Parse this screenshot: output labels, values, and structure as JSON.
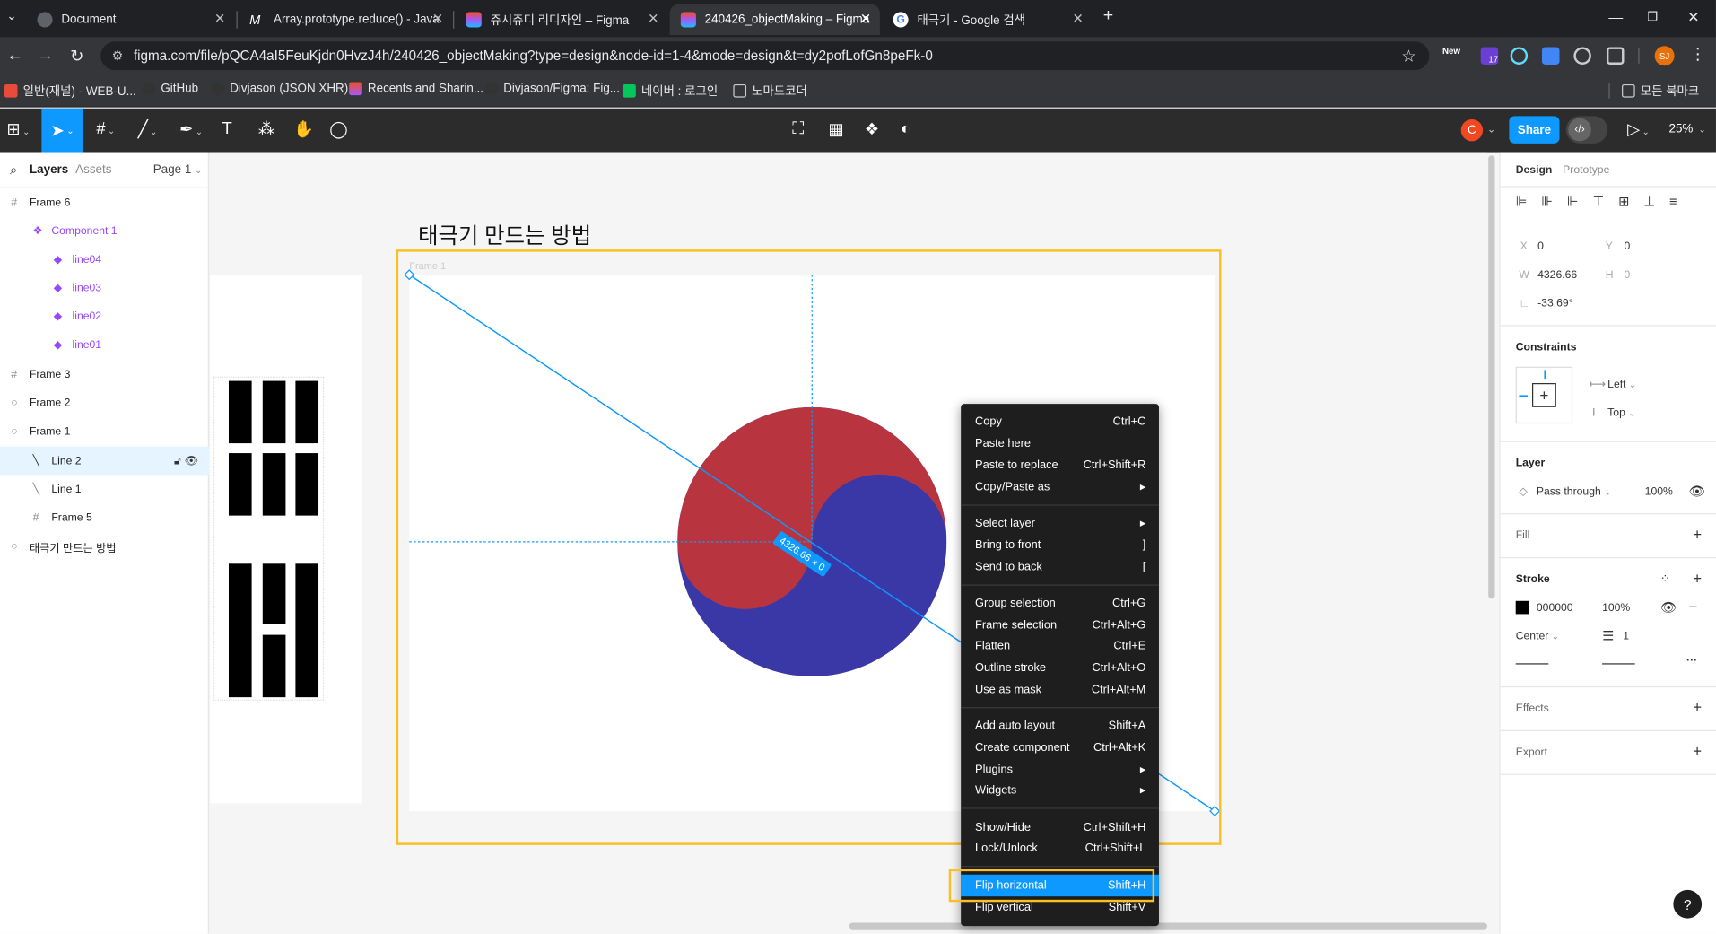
{
  "browser": {
    "tabs": [
      {
        "title": "Document",
        "icon_color": "#5f6368"
      },
      {
        "title": "Array.prototype.reduce() - Java",
        "icon_color": "#ffffff"
      },
      {
        "title": "쥬시쥬디 리디자인 – Figma",
        "icon_color": "#a259ff"
      },
      {
        "title": "240426_objectMaking – Figma",
        "icon_color": "#a259ff"
      },
      {
        "title": "태극기 - Google 검색",
        "icon_color": "#4285f4"
      }
    ],
    "url": "figma.com/file/pQCA4aI5FeuKjdn0HvzJ4h/240426_objectMaking?type=design&node-id=1-4&mode=design&t=dy2pofLofGn8peFk-0",
    "ext_badge": "17",
    "ext_new": "New",
    "profile": "SJ",
    "bookmarks": [
      "일반(재널) - WEB-U...",
      "GitHub",
      "Divjason (JSON XHR)",
      "Recents and Sharin...",
      "Divjason/Figma: Fig...",
      "네이버 : 로그인",
      "노마드코더"
    ],
    "all_bookmarks": "모든 북마크"
  },
  "figma_toolbar": {
    "avatar": "C",
    "share": "Share",
    "zoom": "25%"
  },
  "left_panel": {
    "tab_layers": "Layers",
    "tab_assets": "Assets",
    "page": "Page 1",
    "layers": [
      {
        "name": "Frame 6"
      },
      {
        "name": "Component 1"
      },
      {
        "name": "line04"
      },
      {
        "name": "line03"
      },
      {
        "name": "line02"
      },
      {
        "name": "line01"
      },
      {
        "name": "Frame 3"
      },
      {
        "name": "Frame 2"
      },
      {
        "name": "Frame 1"
      },
      {
        "name": "Line 2"
      },
      {
        "name": "Line 1"
      },
      {
        "name": "Frame 5"
      },
      {
        "name": "태극기 만드는 방법"
      }
    ]
  },
  "canvas": {
    "title": "태극기 만드는 방법",
    "frame_label": "Frame 1",
    "dimension_badge": "4326.66 × 0",
    "colors": {
      "red": "#b8353f",
      "blue": "#3a38a6",
      "selection": "#0d99ff",
      "highlight": "#fbbf24"
    }
  },
  "context_menu": {
    "items": [
      {
        "label": "Copy",
        "shortcut": "Ctrl+C"
      },
      {
        "label": "Paste here",
        "shortcut": ""
      },
      {
        "label": "Paste to replace",
        "shortcut": "Ctrl+Shift+R"
      },
      {
        "label": "Copy/Paste as",
        "shortcut": "▸"
      },
      {
        "label": "Select layer",
        "shortcut": "▸"
      },
      {
        "label": "Bring to front",
        "shortcut": "]"
      },
      {
        "label": "Send to back",
        "shortcut": "["
      },
      {
        "label": "Group selection",
        "shortcut": "Ctrl+G"
      },
      {
        "label": "Frame selection",
        "shortcut": "Ctrl+Alt+G"
      },
      {
        "label": "Flatten",
        "shortcut": "Ctrl+E"
      },
      {
        "label": "Outline stroke",
        "shortcut": "Ctrl+Alt+O"
      },
      {
        "label": "Use as mask",
        "shortcut": "Ctrl+Alt+M"
      },
      {
        "label": "Add auto layout",
        "shortcut": "Shift+A"
      },
      {
        "label": "Create component",
        "shortcut": "Ctrl+Alt+K"
      },
      {
        "label": "Plugins",
        "shortcut": "▸"
      },
      {
        "label": "Widgets",
        "shortcut": "▸"
      },
      {
        "label": "Show/Hide",
        "shortcut": "Ctrl+Shift+H"
      },
      {
        "label": "Lock/Unlock",
        "shortcut": "Ctrl+Shift+L"
      },
      {
        "label": "Flip horizontal",
        "shortcut": "Shift+H"
      },
      {
        "label": "Flip vertical",
        "shortcut": "Shift+V"
      }
    ]
  },
  "right_panel": {
    "tab_design": "Design",
    "tab_prototype": "Prototype",
    "x_label": "X",
    "x_value": "0",
    "y_label": "Y",
    "y_value": "0",
    "w_label": "W",
    "w_value": "4326.66",
    "h_label": "H",
    "h_value": "0",
    "rotation": "-33.69°",
    "constraints_title": "Constraints",
    "constraint_h": "Left",
    "constraint_v": "Top",
    "layer_title": "Layer",
    "blend": "Pass through",
    "opacity": "100%",
    "fill_title": "Fill",
    "stroke_title": "Stroke",
    "stroke_color": "000000",
    "stroke_opacity": "100%",
    "stroke_align": "Center",
    "stroke_weight": "1",
    "effects_title": "Effects",
    "export_title": "Export",
    "help": "?"
  }
}
